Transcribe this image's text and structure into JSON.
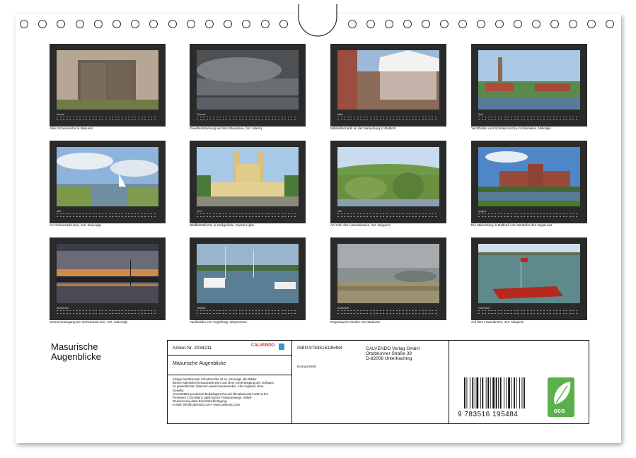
{
  "calendar": {
    "title_line1": "Masurische",
    "title_line2": "Augenblicke",
    "months": [
      {
        "label": "Januar",
        "caption": "Altes Scheunentor in Masuren"
      },
      {
        "label": "Februar",
        "caption": "Gewitterstimmung auf dem Mauersee, Jez. Mamry"
      },
      {
        "label": "März",
        "caption": "Mittelaltermarkt an der Marienburg in Malbork"
      },
      {
        "label": "April",
        "caption": "Yachthafen und Schinkel-Kirche in Nikolaiken, Mikolajki"
      },
      {
        "label": "Mai",
        "caption": "Am Schwenzait-See, Jez. Swiecajty"
      },
      {
        "label": "Juni",
        "caption": "Wallfahrtskirche in Heiligelinde, Swieta Lipka"
      },
      {
        "label": "Juli",
        "caption": "Am Ufer des Löwentinsees, Jez. Niegocin"
      },
      {
        "label": "August",
        "caption": "Die Marienburg in Malbork vom Westufer des Nogat aus"
      },
      {
        "label": "September",
        "caption": "Sonnenuntergang am Schwenzait-See, Jez. Swiecajty"
      },
      {
        "label": "Oktober",
        "caption": "Yachthafen von Angerburg, Wegorzewo"
      },
      {
        "label": "November",
        "caption": "Regentag im Norden von Masuren"
      },
      {
        "label": "Dezember",
        "caption": "Auf dem Löwentinsee, Jez. Niegocin"
      }
    ]
  },
  "info": {
    "article": "Artikel-Nr. 2034211",
    "brand": "CALVENDO",
    "name": "Masurische Augenblicke",
    "legal1": "Infolge bestehender Schutzrechte ist es untersagt, die Blätter",
    "legal2": "dieses Kalenders herauszutrennen und ohne Genehmigung des Verlages",
    "legal3": "zu gewerblichen Zwecken weiterzuverwenden. Alle Angaben ohne",
    "legal4": "Gewähr.",
    "legal5": "CALVENDO produziert bedarfsgerecht und klimabewusst in DE & EU.",
    "legal6": "Positivere CO2-Bilanz dank kurzer Transportwege. Abfall-",
    "legal7": "Reduzierung dank Einzelstückfertigung.",
    "legal8": "E-Mail: info@calvendo.com • www.calvendo.com",
    "isbn": "ISBN 9783516195484",
    "author": "Konrad Weiß",
    "publisher1": "CALVENDO Verlag GmbH",
    "publisher2": "Ottobrunner Straße 39",
    "publisher3": "D-82008 Unterhaching",
    "barcode_number": "9 783516 195484",
    "eco_label": "eco"
  },
  "colors": {
    "thumb_bg": "#2a2a2a",
    "eco_green": "#5ab04a",
    "brand_red": "#c33"
  }
}
